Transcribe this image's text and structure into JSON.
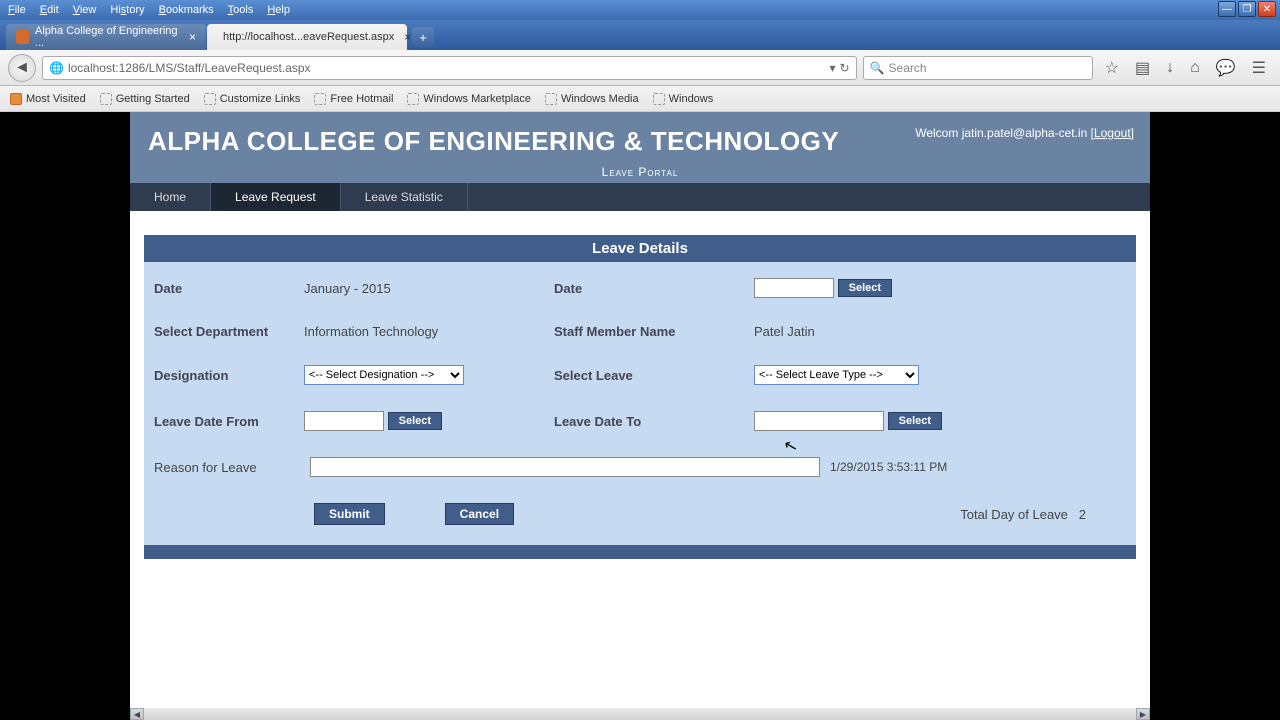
{
  "menu": {
    "file": "File",
    "edit": "Edit",
    "view": "View",
    "history": "History",
    "bookmarks": "Bookmarks",
    "tools": "Tools",
    "help": "Help"
  },
  "tabs": {
    "tab1": "Alpha College of Engineering ...",
    "tab2": "http://localhost...eaveRequest.aspx"
  },
  "url": "localhost:1286/LMS/Staff/LeaveRequest.aspx",
  "search": {
    "placeholder": "Search"
  },
  "bookmarks": {
    "mv": "Most Visited",
    "gs": "Getting Started",
    "cl": "Customize Links",
    "fh": "Free Hotmail",
    "wm": "Windows Marketplace",
    "wmed": "Windows Media",
    "win": "Windows"
  },
  "banner": {
    "title": "ALPHA COLLEGE OF ENGINEERING & TECHNOLOGY",
    "subtitle": "Leave Portal",
    "welcome_prefix": "Welcom ",
    "welcome_email": "jatin.patel@alpha-cet.in",
    "logout": "Logout"
  },
  "nav": {
    "home": "Home",
    "leave_request": "Leave Request",
    "leave_stat": "Leave Statistic"
  },
  "panel": {
    "header": "Leave Details",
    "labels": {
      "date_left": "Date",
      "date_right": "Date",
      "dept": "Select Department",
      "staff": "Staff Member Name",
      "desig": "Designation",
      "leave": "Select Leave",
      "from": "Leave Date From",
      "to": "Leave Date To",
      "reason": "Reason for Leave",
      "total": "Total Day of Leave"
    },
    "values": {
      "date_left": "January - 2015",
      "dept": "Information Technology",
      "staff": "Patel Jatin",
      "desig_placeholder": "<-- Select Designation -->",
      "leave_placeholder": "<-- Select Leave Type -->",
      "timestamp": "1/29/2015 3:53:11 PM",
      "total_days": "2"
    },
    "buttons": {
      "select": "Select",
      "submit": "Submit",
      "cancel": "Cancel"
    }
  }
}
